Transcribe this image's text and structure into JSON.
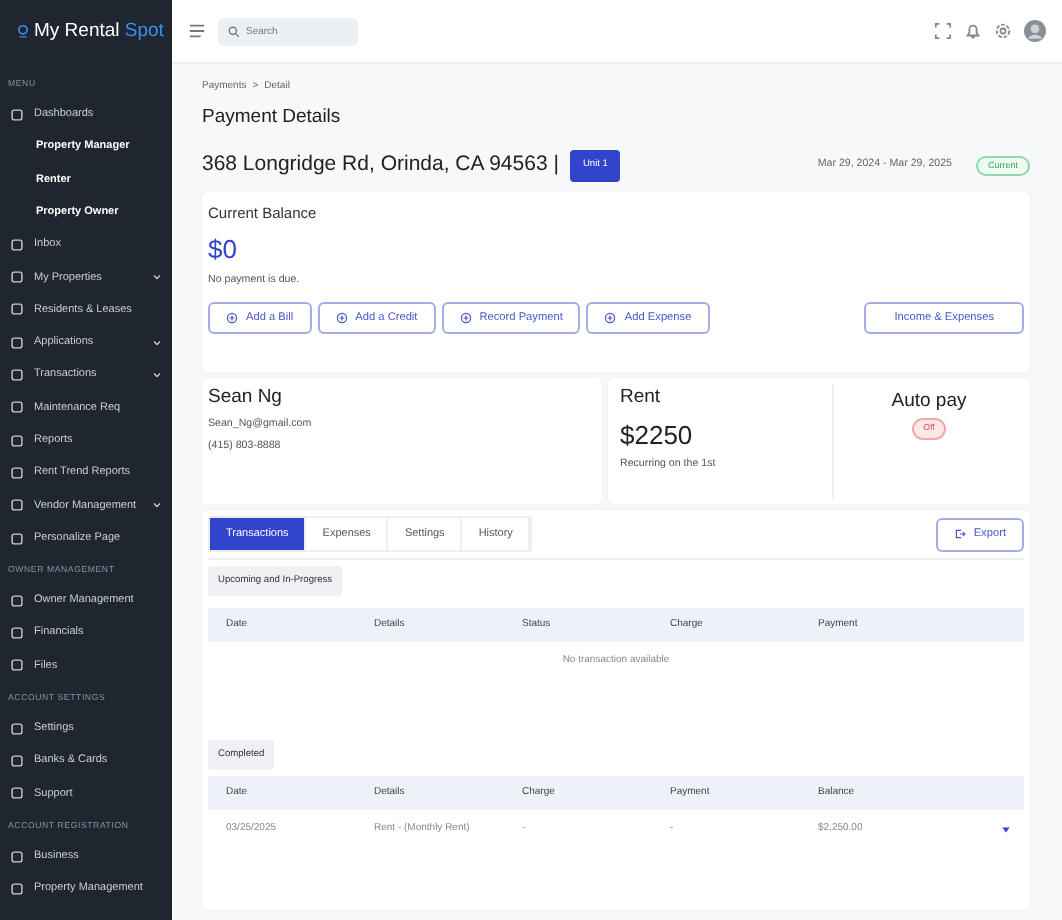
{
  "sidebar": {
    "logo": {
      "text": "My Rental ",
      "accent": "Spot"
    },
    "sections": [
      {
        "heading": "MENU",
        "items": [
          {
            "label": "Dashboards",
            "kind": "item",
            "expandable": false
          },
          {
            "label": "Property Manager",
            "kind": "subitem",
            "expandable": false
          },
          {
            "label": "Renter",
            "kind": "subitem",
            "expandable": false
          },
          {
            "label": "Property Owner",
            "kind": "subitem",
            "expandable": false
          },
          {
            "label": "Inbox",
            "kind": "item",
            "expandable": false
          },
          {
            "label": "My Properties",
            "kind": "item",
            "expandable": true
          },
          {
            "label": "Residents & Leases",
            "kind": "item",
            "expandable": false
          },
          {
            "label": "Applications",
            "kind": "item",
            "expandable": true
          },
          {
            "label": "Transactions",
            "kind": "item",
            "expandable": true
          },
          {
            "label": "Maintenance Req",
            "kind": "item",
            "expandable": false
          },
          {
            "label": "Reports",
            "kind": "item",
            "expandable": false
          },
          {
            "label": "Rent Trend Reports",
            "kind": "item",
            "expandable": false
          },
          {
            "label": "Vendor Management",
            "kind": "item",
            "expandable": true
          },
          {
            "label": "Personalize Page",
            "kind": "item",
            "expandable": false
          }
        ]
      },
      {
        "heading": "OWNER MANAGEMENT",
        "items": [
          {
            "label": "Owner Management",
            "kind": "item",
            "expandable": false
          },
          {
            "label": "Financials",
            "kind": "item",
            "expandable": false
          },
          {
            "label": "Files",
            "kind": "item",
            "expandable": false
          }
        ]
      },
      {
        "heading": "ACCOUNT SETTINGS",
        "items": [
          {
            "label": "Settings",
            "kind": "item",
            "expandable": false
          },
          {
            "label": "Banks & Cards",
            "kind": "item",
            "expandable": false
          },
          {
            "label": "Support",
            "kind": "item",
            "expandable": false
          }
        ]
      },
      {
        "heading": "ACCOUNT REGISTRATION",
        "items": [
          {
            "label": "Business",
            "kind": "item",
            "expandable": false
          },
          {
            "label": "Property Management",
            "kind": "item",
            "expandable": false
          }
        ]
      }
    ]
  },
  "topbar": {
    "search": {
      "placeholder": "Search"
    }
  },
  "breadcrumb": {
    "items": [
      "Payments",
      "Detail"
    ],
    "separator": ">"
  },
  "title": "Payment Details",
  "lease": {
    "address": "368 Longridge Rd, Orinda, CA 94563 |",
    "unit": "Unit 1",
    "dates": "Mar 29, 2024 - Mar 29, 2025",
    "status": "Current"
  },
  "balance": {
    "label": "Current Balance",
    "amount": "$0",
    "note": "No payment is due.",
    "buttons": [
      "Add a Bill",
      "Add a Credit",
      "Record Payment",
      "Add Expense"
    ],
    "side_button": "Income & Expenses"
  },
  "contact": {
    "name": "Sean Ng",
    "email": "Sean_Ng@gmail.com",
    "phone": "(415) 803-8888"
  },
  "rent": {
    "label": "Rent",
    "amount": "$2250",
    "note": "Recurring on the 1st",
    "autopay_label": "Auto pay",
    "autopay_status": "Off"
  },
  "tabs": [
    {
      "label": "Transactions",
      "selected": true
    },
    {
      "label": "Expenses",
      "selected": false
    },
    {
      "label": "Settings",
      "selected": false
    },
    {
      "label": "History",
      "selected": false
    }
  ],
  "export_button": "Export",
  "upcoming": {
    "label": "Upcoming and In-Progress",
    "columns": [
      "Date",
      "Details",
      "Status",
      "Charge",
      "Payment"
    ],
    "empty": "No transaction available"
  },
  "completed": {
    "label": "Completed",
    "columns": [
      "Date",
      "Details",
      "Charge",
      "Payment",
      "Balance"
    ],
    "rows": [
      [
        "03/25/2025",
        "Rent - (Monthly Rent)",
        "-",
        "-",
        "$2,250.00"
      ]
    ]
  }
}
